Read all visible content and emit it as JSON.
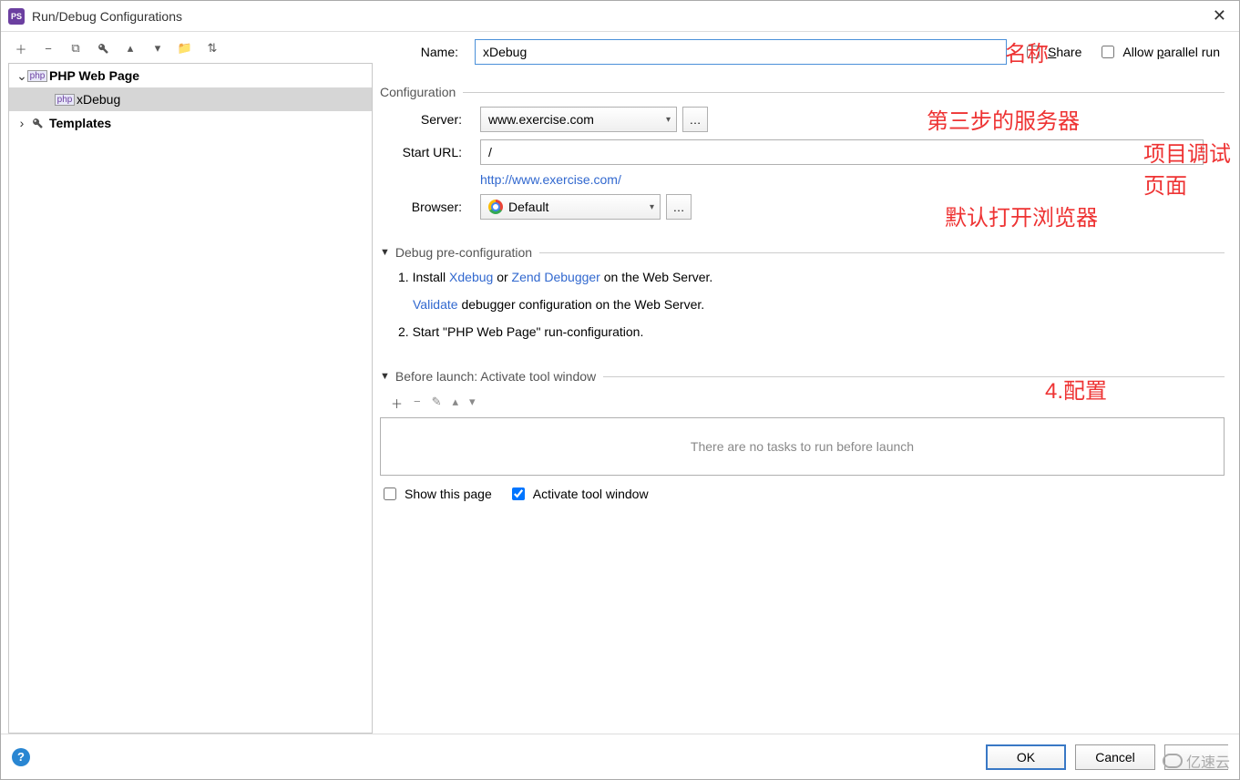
{
  "title": "Run/Debug Configurations",
  "tree": {
    "group1": "PHP Web Page",
    "child1": "xDebug",
    "group2": "Templates"
  },
  "name": {
    "label": "Name:",
    "value": "xDebug"
  },
  "share": {
    "label": "Share",
    "accel": "S"
  },
  "parallel": {
    "label": "Allow parallel run",
    "accel": "p"
  },
  "annotations": {
    "name_anno": "名称",
    "server_anno": "第三步的服务器",
    "url_anno": "项目调试页面",
    "browser_anno": "默认打开浏览器",
    "config_anno": "4.配置"
  },
  "config": {
    "section": "Configuration",
    "server_label": "Server:",
    "server_value": "www.exercise.com",
    "starturl_label": "Start URL:",
    "starturl_value": "/",
    "full_url": "http://www.exercise.com/",
    "browser_label": "Browser:",
    "browser_value": "Default"
  },
  "debugpre": {
    "title": "Debug pre-configuration",
    "step1a": "1. Install ",
    "xdebug": "Xdebug",
    "or": " or  ",
    "zend": "Zend Debugger",
    "step1b": " on the Web Server.",
    "validate": "Validate",
    "validate_after": " debugger configuration on the Web Server.",
    "step2": "2. Start \"PHP Web Page\" run-configuration."
  },
  "before": {
    "title": "Before launch: Activate tool window",
    "empty": "There are no tasks to run before launch"
  },
  "checkboxes": {
    "show": "Show this page",
    "activate": "Activate tool window"
  },
  "buttons": {
    "ok": "OK",
    "cancel": "Cancel"
  },
  "watermark": "亿速云"
}
